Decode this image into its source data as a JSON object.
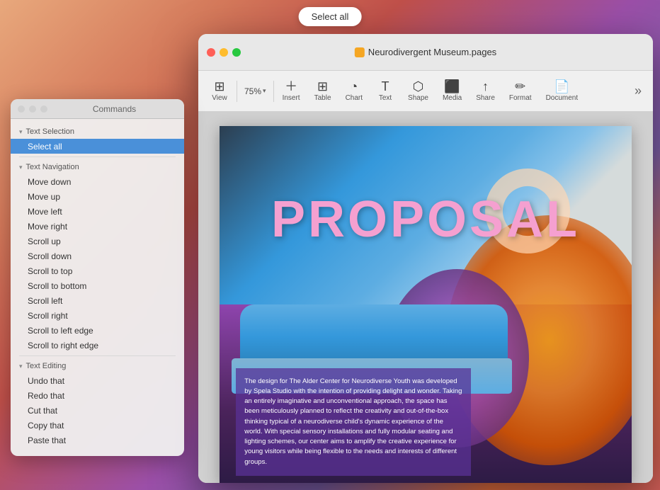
{
  "select_all_btn": "Select all",
  "pages_window": {
    "title": "Neurodivergent Museum.pages",
    "traffic_lights": {
      "close": "close",
      "minimize": "minimize",
      "maximize": "maximize"
    },
    "toolbar": {
      "view_label": "View",
      "zoom_value": "75%",
      "insert_label": "Insert",
      "table_label": "Table",
      "chart_label": "Chart",
      "text_label": "Text",
      "shape_label": "Shape",
      "media_label": "Media",
      "share_label": "Share",
      "format_label": "Format",
      "document_label": "Document",
      "more_label": "»"
    },
    "page": {
      "proposal_text": "PROPOSAL",
      "body_text": "The design for The Alder Center for Neurodiverse Youth was developed by Spela Studio with the intention of providing delight and wonder. Taking an entirely imaginative and unconventional approach, the space has been meticulously planned to reflect the creativity and out-of-the-box thinking typical of a neurodiverse child's dynamic experience of the world. With special sensory installations and fully modular seating and lighting schemes, our center aims to amplify the creative experience for young visitors while being flexible to the needs and interests of different groups."
    }
  },
  "commands_panel": {
    "title": "Commands",
    "sections": [
      {
        "id": "text-selection",
        "header": "Text Selection",
        "items": [
          {
            "label": "Select all",
            "selected": true
          }
        ]
      },
      {
        "id": "text-navigation",
        "header": "Text Navigation",
        "items": [
          {
            "label": "Move down",
            "selected": false
          },
          {
            "label": "Move up",
            "selected": false
          },
          {
            "label": "Move left",
            "selected": false
          },
          {
            "label": "Move right",
            "selected": false
          },
          {
            "label": "Scroll up",
            "selected": false
          },
          {
            "label": "Scroll down",
            "selected": false
          },
          {
            "label": "Scroll to top",
            "selected": false
          },
          {
            "label": "Scroll to bottom",
            "selected": false
          },
          {
            "label": "Scroll left",
            "selected": false
          },
          {
            "label": "Scroll right",
            "selected": false
          },
          {
            "label": "Scroll to left edge",
            "selected": false
          },
          {
            "label": "Scroll to right edge",
            "selected": false
          }
        ]
      },
      {
        "id": "text-editing",
        "header": "Text Editing",
        "items": [
          {
            "label": "Undo that",
            "selected": false
          },
          {
            "label": "Redo that",
            "selected": false
          },
          {
            "label": "Cut that",
            "selected": false
          },
          {
            "label": "Copy that",
            "selected": false
          },
          {
            "label": "Paste that",
            "selected": false
          }
        ]
      }
    ]
  }
}
